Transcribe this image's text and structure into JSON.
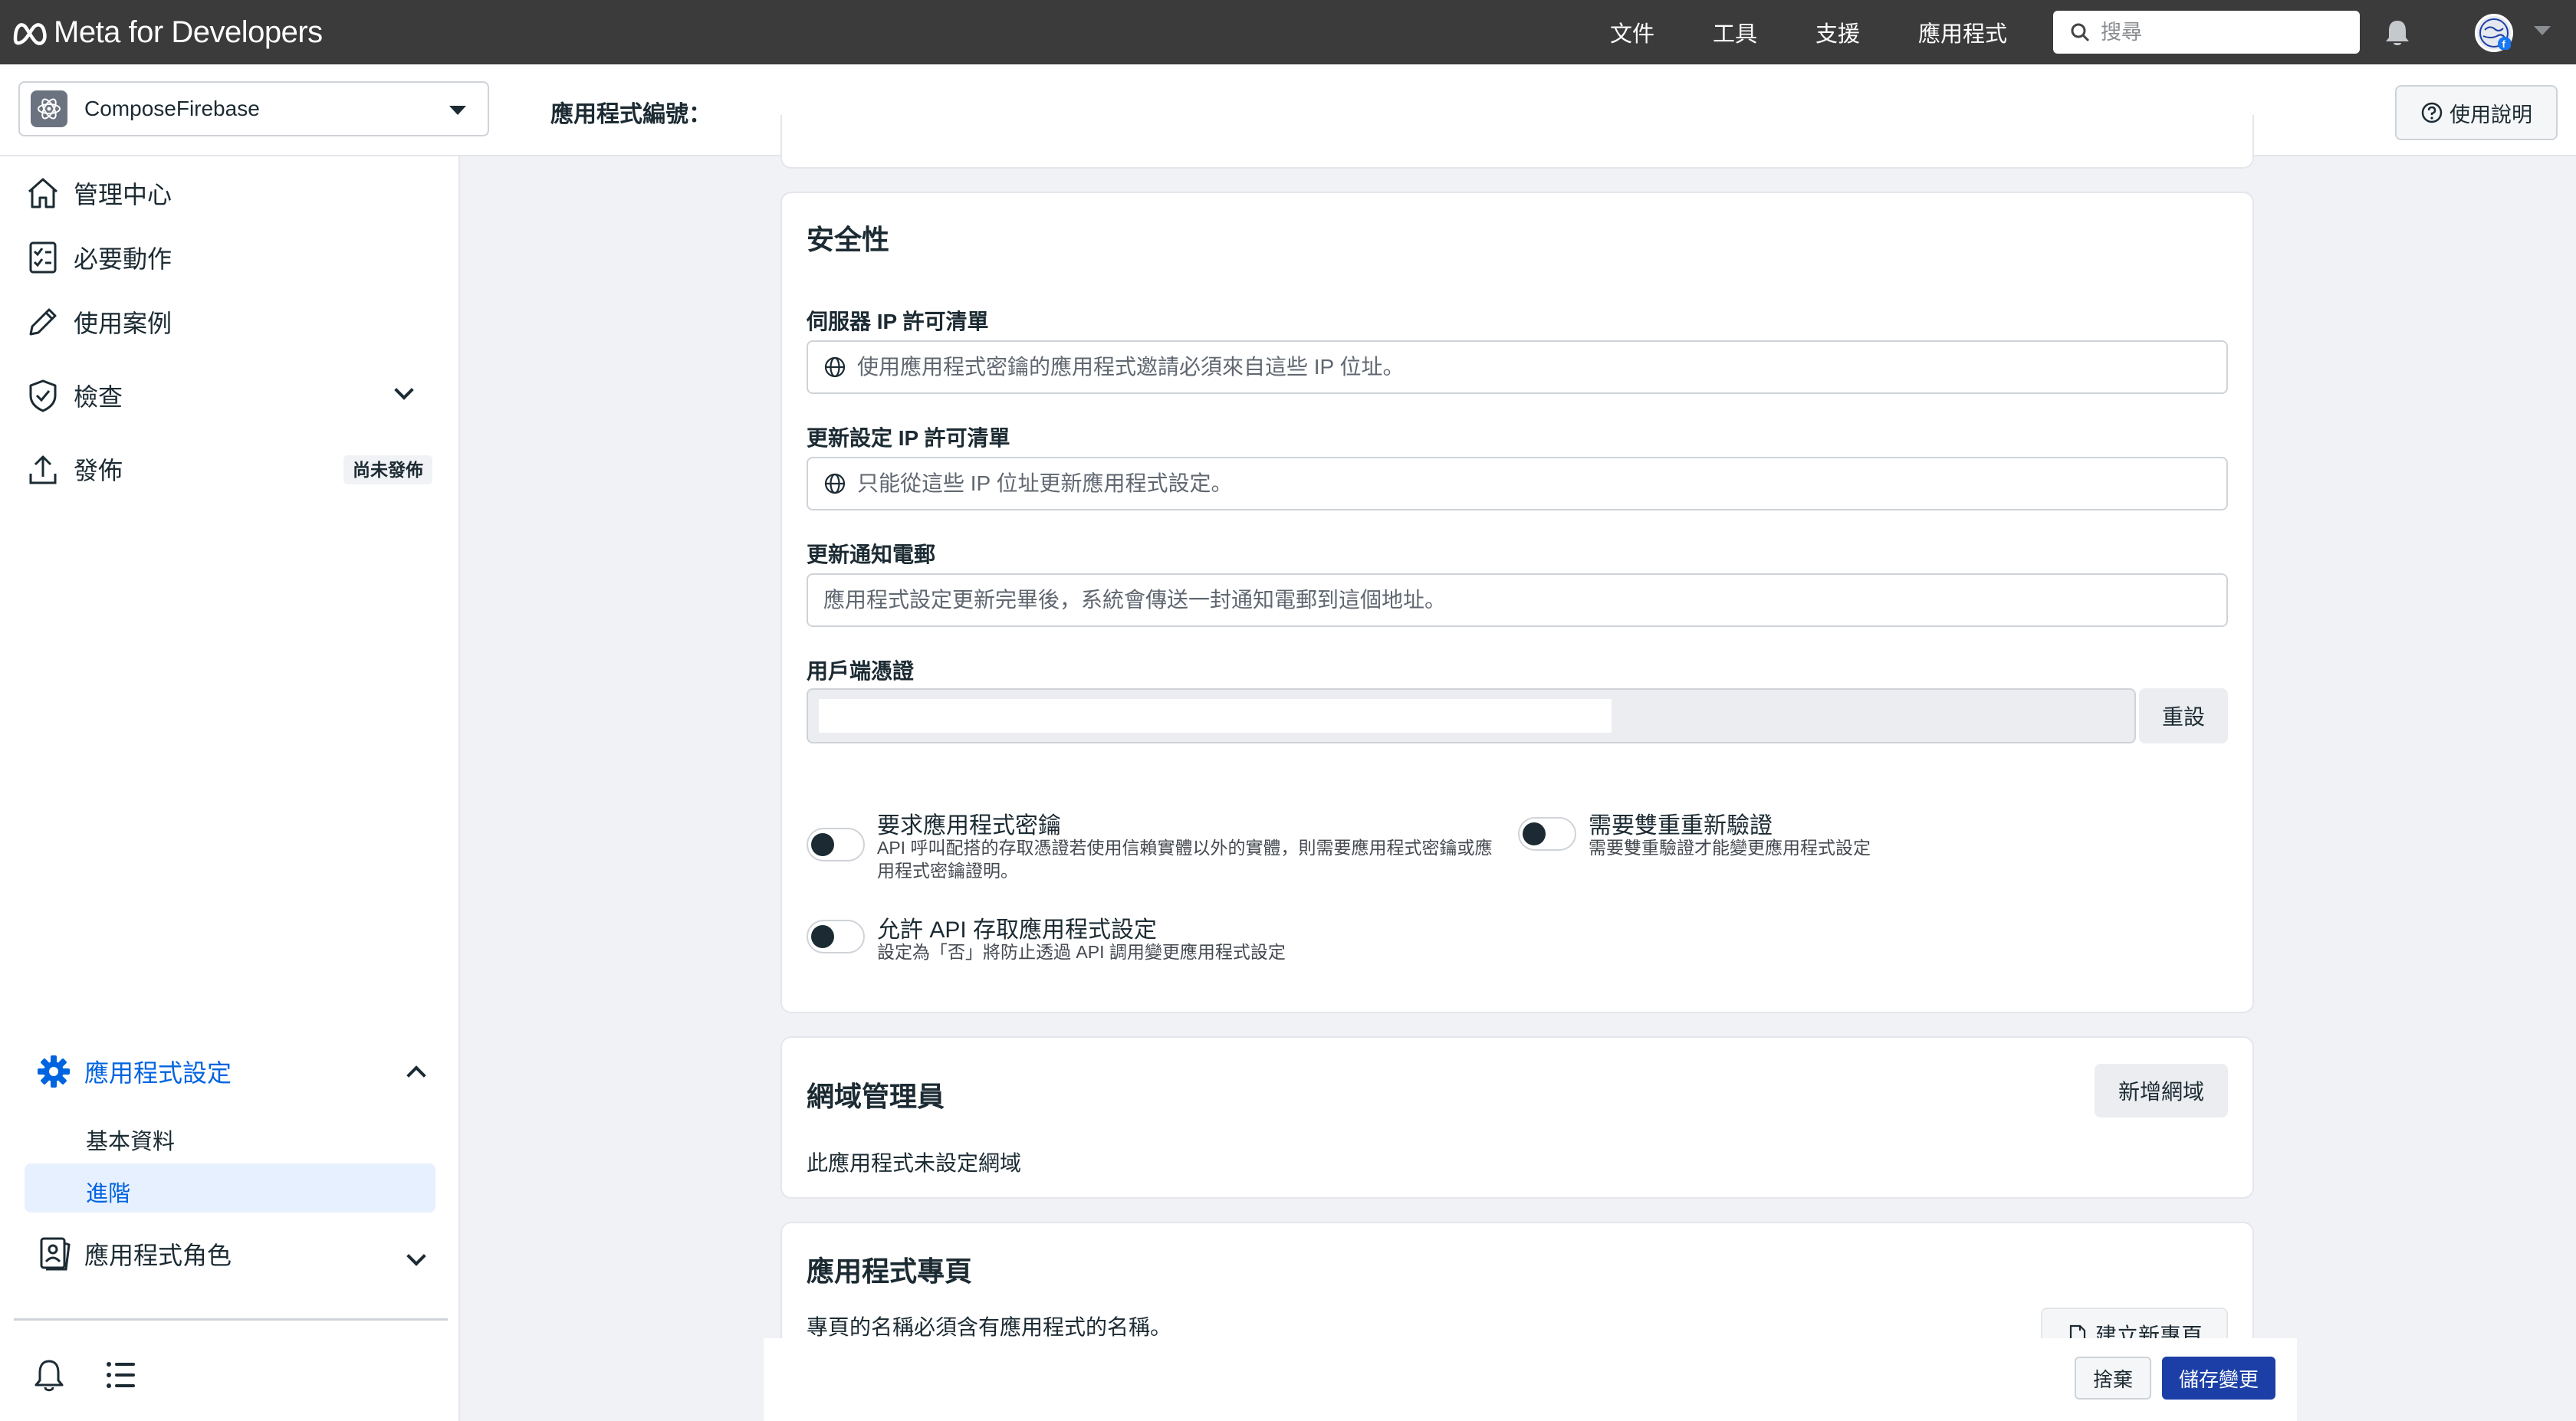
{
  "header": {
    "brand": "Meta for Developers",
    "nav": [
      "文件",
      "工具",
      "支援",
      "應用程式"
    ],
    "search_placeholder": "搜尋"
  },
  "subheader": {
    "app_name": "ComposeFirebase",
    "app_id_label": "應用程式編號：",
    "help_label": "使用說明"
  },
  "sidebar": {
    "items": [
      {
        "label": "管理中心"
      },
      {
        "label": "必要動作"
      },
      {
        "label": "使用案例"
      },
      {
        "label": "檢查"
      },
      {
        "label": "發佈",
        "badge": "尚未發佈"
      }
    ],
    "settings": {
      "label": "應用程式設定",
      "sub": [
        "基本資料",
        "進階"
      ]
    },
    "roles": {
      "label": "應用程式角色"
    }
  },
  "security": {
    "title": "安全性",
    "server_ip_label": "伺服器 IP 許可清單",
    "server_ip_placeholder": "使用應用程式密鑰的應用程式邀請必須來自這些 IP 位址。",
    "update_ip_label": "更新設定 IP 許可清單",
    "update_ip_placeholder": "只能從這些 IP 位址更新應用程式設定。",
    "notify_email_label": "更新通知電郵",
    "notify_email_placeholder": "應用程式設定更新完畢後，系統會傳送一封通知電郵到這個地址。",
    "client_token_label": "用戶端憑證",
    "reset_label": "重設",
    "toggles": {
      "require_secret": {
        "title": "要求應用程式密鑰",
        "desc1": "API 呼叫配搭的存取憑證若使用信賴實體以外的實體，則需要應用程式密鑰或應",
        "desc2": "用程式密鑰證明。",
        "on": false
      },
      "require_2fa": {
        "title": "需要雙重重新驗證",
        "desc": "需要雙重驗證才能變更應用程式設定",
        "on": false
      },
      "allow_api": {
        "title": "允許 API 存取應用程式設定",
        "desc": "設定為「否」將防止透過 API 調用變更應用程式設定",
        "on": false
      }
    }
  },
  "domain_manager": {
    "title": "網域管理員",
    "add_label": "新增網域",
    "empty_text": "此應用程式未設定網域"
  },
  "app_page": {
    "title": "應用程式專頁",
    "desc": "專頁的名稱必須含有應用程式的名稱。",
    "create_label": "建立新專頁"
  },
  "footer": {
    "discard_label": "捨棄",
    "save_label": "儲存變更"
  },
  "colors": {
    "topbar": "#3b3b3b",
    "accent": "#0064e0",
    "save_button": "#1b3fa6"
  }
}
